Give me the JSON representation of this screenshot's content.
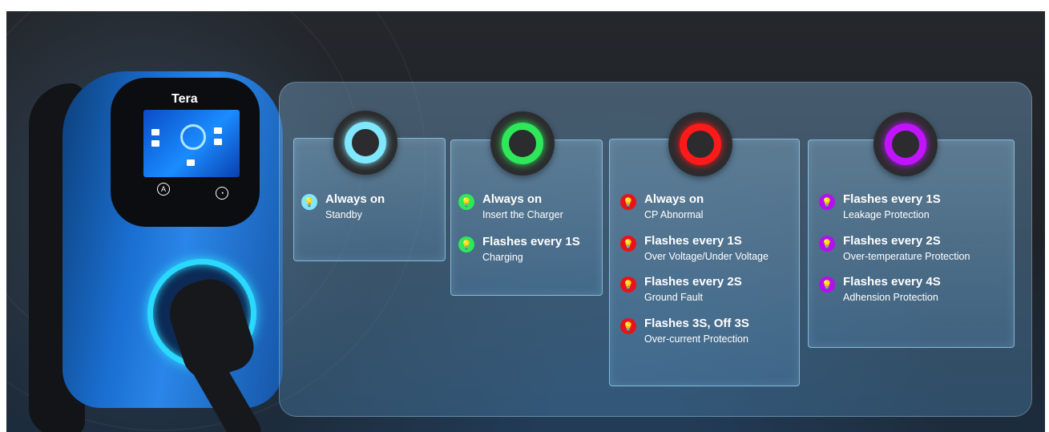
{
  "brand": "Tera",
  "colors": {
    "standby": "#7fe8ff",
    "charging": "#2ee85a",
    "fault": "#ff1a1a",
    "protection": "#c014ff",
    "socket_glow": "#2bd9ff",
    "charger_body": "#1a6fd1"
  },
  "groups": [
    {
      "led_color": "#7fe8ff",
      "items": [
        {
          "icon": "bulb-icon",
          "title": "Always on",
          "desc": "Standby"
        }
      ]
    },
    {
      "led_color": "#2ee85a",
      "items": [
        {
          "icon": "bulb-icon",
          "title": "Always on",
          "desc": "Insert the Charger"
        },
        {
          "icon": "flashing-bulb-icon",
          "title": "Flashes every 1S",
          "desc": "Charging"
        }
      ]
    },
    {
      "led_color": "#ff1a1a",
      "items": [
        {
          "icon": "flashing-bulb-icon",
          "title": "Always on",
          "desc": "CP Abnormal"
        },
        {
          "icon": "flashing-bulb-icon",
          "title": "Flashes every 1S",
          "desc": "Over Voltage/Under Voltage"
        },
        {
          "icon": "flashing-bulb-icon",
          "title": "Flashes every 2S",
          "desc": "Ground Fault"
        },
        {
          "icon": "flashing-bulb-icon",
          "title": "Flashes 3S, Off 3S",
          "desc": "Over-current Protection"
        }
      ]
    },
    {
      "led_color": "#c014ff",
      "items": [
        {
          "icon": "flashing-bulb-icon",
          "title": "Flashes every 1S",
          "desc": "Leakage Protection"
        },
        {
          "icon": "flashing-bulb-icon",
          "title": "Flashes every 2S",
          "desc": "Over-temperature Protection"
        },
        {
          "icon": "flashing-bulb-icon",
          "title": "Flashes every 4S",
          "desc": "Adhension Protection"
        }
      ]
    }
  ]
}
